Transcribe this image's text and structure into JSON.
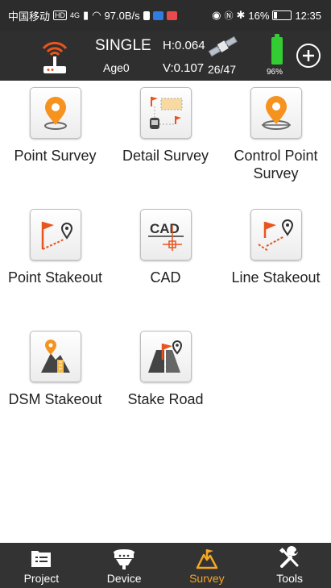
{
  "status_bar": {
    "carrier": "中国移动",
    "signal": "4G",
    "net_speed": "97.0B/s",
    "battery_pct": "16%",
    "time": "12:35"
  },
  "header": {
    "mode": "SINGLE",
    "age": "Age0",
    "h_precision": "H:0.064",
    "v_precision": "V:0.107",
    "satellites": "26/47",
    "battery": "96%",
    "battery_level": 0.96,
    "battery_color": "#33cc33"
  },
  "grid": {
    "items": [
      {
        "label": "Point Survey",
        "icon": "location-pin-icon"
      },
      {
        "label": "Detail Survey",
        "icon": "detail-survey-icon"
      },
      {
        "label": "Control Point Survey",
        "icon": "control-point-icon"
      },
      {
        "label": "Point Stakeout",
        "icon": "point-stakeout-icon"
      },
      {
        "label": "CAD",
        "icon": "cad-icon"
      },
      {
        "label": "Line Stakeout",
        "icon": "line-stakeout-icon"
      },
      {
        "label": "DSM Stakeout",
        "icon": "dsm-stakeout-icon"
      },
      {
        "label": "Stake Road",
        "icon": "stake-road-icon"
      }
    ]
  },
  "bottom_nav": {
    "active_color": "#f5a623",
    "items": [
      {
        "label": "Project",
        "icon": "project-list-icon"
      },
      {
        "label": "Device",
        "icon": "gnss-receiver-icon"
      },
      {
        "label": "Survey",
        "icon": "survey-icon",
        "active": true
      },
      {
        "label": "Tools",
        "icon": "tools-icon"
      }
    ]
  }
}
